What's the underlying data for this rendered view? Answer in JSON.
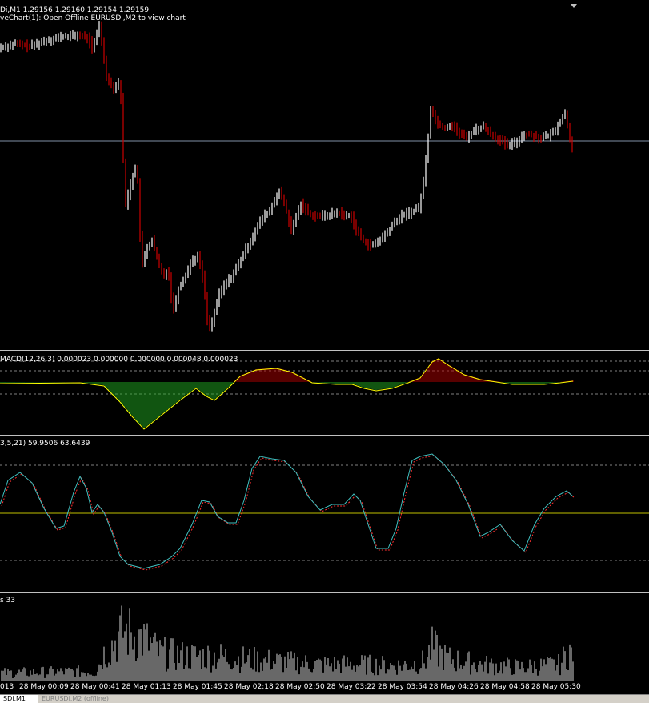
{
  "main_chart": {
    "title_line1": "Di,M1  1.29156 1.29160 1.29154 1.29159",
    "title_line2": "veChart(1): Open Offline EURUSDi,M2 to view chart"
  },
  "macd": {
    "label": "MACD(12,26,3) 0.000023 0.000000 0.000000 0.000048 0.000023"
  },
  "stoch": {
    "label": "3,5,21) 59.9506 63.6439"
  },
  "volume": {
    "label": "s 33"
  },
  "time_axis": {
    "ticks": [
      "013",
      "28 May 00:09",
      "28 May 00:41",
      "28 May 01:13",
      "28 May 01:45",
      "28 May 02:18",
      "28 May 02:50",
      "28 May 03:22",
      "28 May 03:54",
      "28 May 04:26",
      "28 May 04:58",
      "28 May 05:30"
    ]
  },
  "tabs": [
    {
      "label": "SDi,M1",
      "active": true
    },
    {
      "label": "EURUSDi,M2 (offline)",
      "active": false
    }
  ],
  "colors": {
    "bull": "#ffffff",
    "bear": "#cc0000",
    "macd_pos": "#b00000",
    "macd_neg": "#22aa22",
    "macd_signal": "#ffff00",
    "stoch_main": "#40c0c0",
    "stoch_signal": "#ff3030",
    "level_line": "#c0c000",
    "price_line": "#7f8fa6",
    "separator": "#c0c0c0"
  }
}
